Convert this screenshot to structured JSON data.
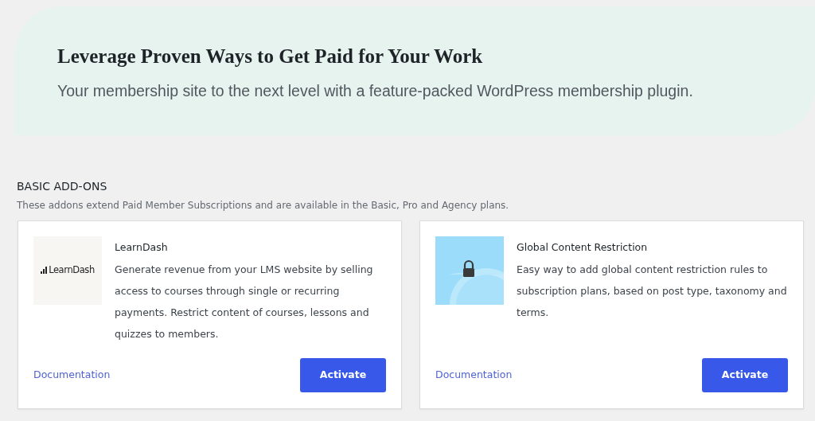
{
  "hero": {
    "title": "Leverage Proven Ways to Get Paid for Your Work",
    "subtitle": "Your membership site to the next level with a feature-packed WordPress membership plugin."
  },
  "section": {
    "heading": "BASIC ADD-ONS",
    "description": "These addons extend Paid Member Subscriptions and are available in the Basic, Pro and Agency plans."
  },
  "addons": [
    {
      "thumbnail": {
        "kind": "logo",
        "text": "LearnDash"
      },
      "name": "LearnDash",
      "description": "Generate revenue from your LMS website by selling access to courses through single or recurring payments. Restrict content of courses, lessons and quizzes to members.",
      "link": "Documentation",
      "button": "Activate"
    },
    {
      "name": "Global Content Restriction",
      "description": "Easy way to add global content restriction rules to subscription plans, based on post type, taxonomy and terms.",
      "link": "Documentation",
      "button": "Activate"
    }
  ]
}
